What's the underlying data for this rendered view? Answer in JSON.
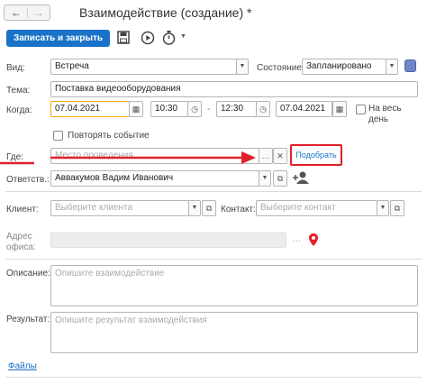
{
  "header": {
    "title": "Взаимодействие (создание) *",
    "back_icon": "arrow-left-icon",
    "forward_icon": "arrow-right-icon"
  },
  "toolbar": {
    "save_close_label": "Записать и закрыть",
    "save_icon": "floppy-icon",
    "play_icon": "play-icon",
    "timer_icon": "stopwatch-icon",
    "more_icon": "triangle-down-icon"
  },
  "form": {
    "vid_label": "Вид:",
    "vid_value": "Встреча",
    "status_label": "Состояние:",
    "status_value": "Запланировано",
    "tema_label": "Тема:",
    "tema_value": "Поставка видеооборудования",
    "kogda_label": "Когда:",
    "start_date": "07.04.2021",
    "start_time": "10:30",
    "dash": "-",
    "end_time": "12:30",
    "end_date": "07.04.2021",
    "allday_label_1": "На весь",
    "allday_label_2": "день",
    "repeat_label": "Повторять событие",
    "gde_label": "Где:",
    "gde_placeholder": "Место проведения",
    "pick_label": "Подобрать",
    "otvetstv_label": "Ответств.:",
    "otvetstv_value": "Аввакумов Вадим Иванович",
    "client_label": "Клиент:",
    "client_placeholder": "Выберите клиента",
    "contact_label": "Контакт:",
    "contact_placeholder": "Выберите контакт",
    "address_label_1": "Адрес",
    "address_label_2": "офиса:",
    "opisanie_label": "Описание:",
    "opisanie_placeholder": "Опишите взаимодействие",
    "result_label": "Результат:",
    "result_placeholder": "Опишите результат взаимодействия",
    "files_link": "Файлы"
  },
  "colors": {
    "primary": "#1a73c8",
    "highlight_red": "#e0202a",
    "focus_orange": "#f2a500"
  }
}
